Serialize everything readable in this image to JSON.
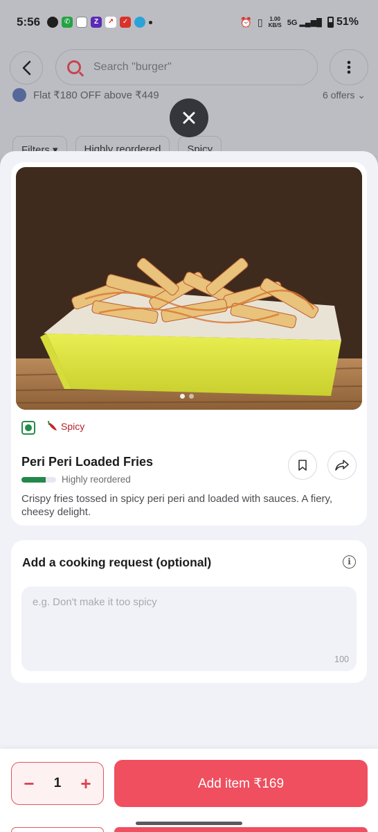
{
  "status_bar": {
    "time": "5:56",
    "net_speed": "1.00",
    "net_unit": "KB/S",
    "signal": "5G",
    "battery": "51%"
  },
  "header": {
    "search_placeholder": "Search \"burger\"",
    "offer_text": "Flat ₹180 OFF above ₹449",
    "offers_count": "6 offers"
  },
  "filters": [
    {
      "label": "Filters ▾"
    },
    {
      "label": "Highly reordered"
    },
    {
      "label": "Spicy"
    }
  ],
  "item": {
    "tag": "Spicy",
    "name": "Peri Peri Loaded Fries",
    "reorder_label": "Highly reordered",
    "reorder_level": 0.7,
    "description": "Crispy fries tossed in spicy peri peri and loaded with sauces. A fiery, cheesy delight.",
    "image_count": 2
  },
  "cooking_request": {
    "title": "Add a cooking request (optional)",
    "placeholder": "e.g. Don't make it too spicy",
    "char_limit": "100"
  },
  "footer": {
    "quantity": "1",
    "minus": "−",
    "plus": "+",
    "add_label": "Add item ₹169"
  },
  "colors": {
    "accent": "#ef4f5f",
    "veg": "#258b4a",
    "spicy": "#b4222a"
  }
}
